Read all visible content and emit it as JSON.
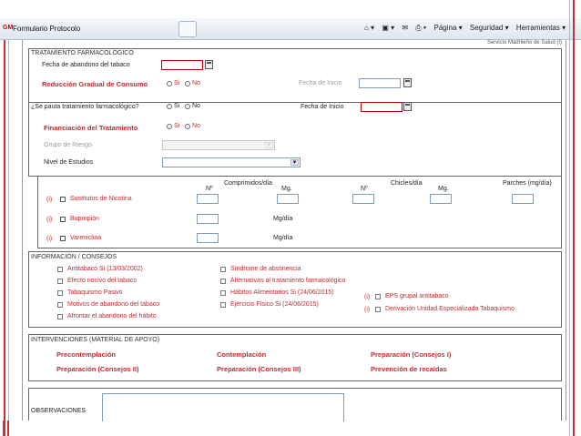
{
  "browser": {
    "window_title": "Formulario Protocolo",
    "logo": "GM",
    "tools": {
      "pagina": "Página ▾",
      "seguridad": "Seguridad ▾",
      "herramientas": "Herramientas ▾"
    }
  },
  "cut_text": "Servicio Madrileño de Salud (I)",
  "tratamiento": {
    "title": "TRATAMIENTO FARMACOLÓGICO",
    "fecha_abandono_label": "Fecha de abandono del tabaco",
    "reduccion_label": "Reducción Gradual de Consumo",
    "radio_si": "Si",
    "radio_no": "No",
    "fecha_inicio_label": "Fecha de Inicio"
  },
  "pauta": {
    "question": "¿Se pauta tratamiento farmacológico?",
    "radio_si": "Si",
    "radio_no": "No",
    "fecha_inicio_label": "Fecha de Inicio",
    "financiacion_label": "Financiación del Tratamiento",
    "grupo_riesgo_label": "Grupo de Riesgo",
    "nivel_estudios_label": "Nivel de Estudios"
  },
  "farmacos": {
    "col_n1": "Nº",
    "col_comprimidos": "Comprimidos/día",
    "col_mg1": "Mg.",
    "col_n2": "Nº",
    "col_chicles": "Chicles/día",
    "col_mg2": "Mg.",
    "col_parches": "Parches (mg/día)",
    "info_marker": "(i)",
    "sustitutos": "Sustitutos de Nicotina",
    "bupropion": "Bupropión",
    "vareniclina": "Vareniclina",
    "mgdia1": "Mg/día",
    "mgdia2": "Mg/día"
  },
  "informacion": {
    "title": "INFORMACIÓN / CONSEJOS",
    "col1": [
      "Antitabaco  Si (13/03/2002)",
      "Efecto nocivo del tabaco",
      "Tabaquismo Pasivo",
      "Motivos de abandono del tabaco",
      "Afrontar el abandono del hábito"
    ],
    "col2": [
      "Síndrome de abstinencia",
      "Alternativas al tratamiento farmacológico",
      "Hábitos Alimentarios  Si (24/06/2015)",
      "Ejercicio Físico  Si (24/06/2015)"
    ],
    "col3_marker": "(i)",
    "col3": [
      "EPS grupal antitabaco",
      "Derivación Unidad Especializada Tabaquismo"
    ]
  },
  "intervenciones": {
    "title": "INTERVENCIONES (MATERIAL DE APOYO)",
    "items": [
      "Precontemplación",
      "Contemplación",
      "Preparación (Consejos I)",
      "Preparación (Consejos II)",
      "Preparación (Consejos III)",
      "Prevención de recaídas"
    ]
  },
  "observaciones": {
    "label": "OBSERVACIONES"
  }
}
